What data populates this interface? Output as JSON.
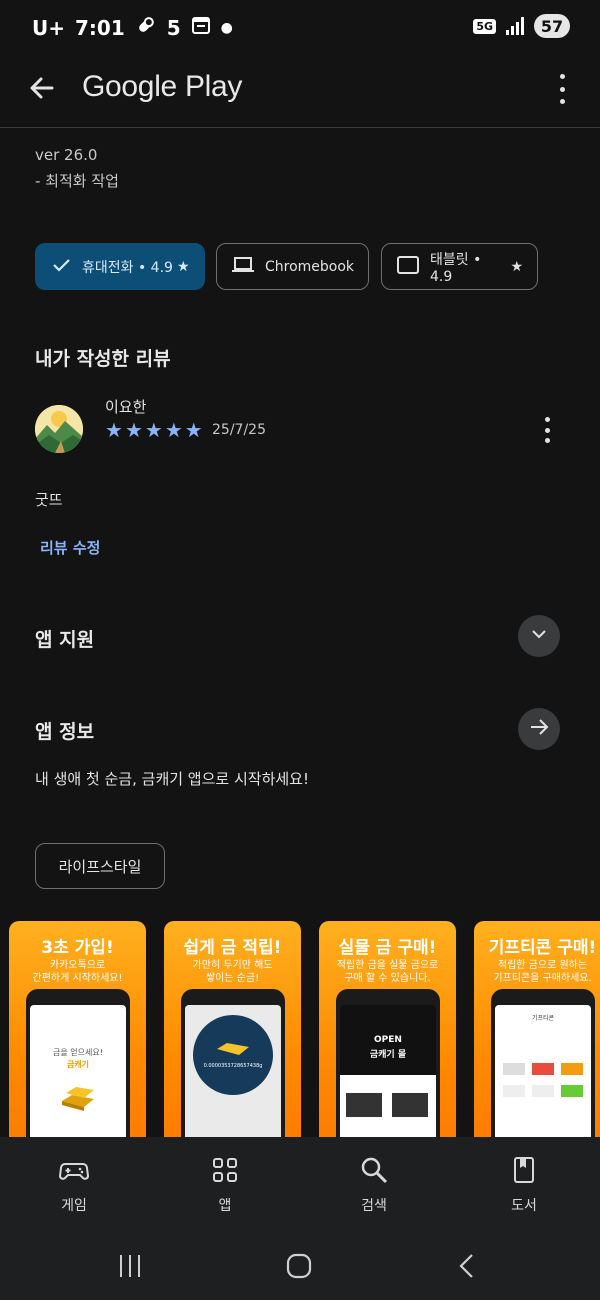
{
  "status_bar": {
    "carrier": "U+",
    "time": "7:01",
    "notification_count": "5",
    "network": "5G",
    "battery": "57"
  },
  "app_bar": {
    "title": "Google Play"
  },
  "whats_new": {
    "version": "ver 26.0",
    "note": "- 최적화 작업"
  },
  "device_chips": [
    {
      "label": "휴대전화 • 4.9",
      "icon": "check-icon",
      "star": true,
      "selected": true
    },
    {
      "label": "Chromebook",
      "icon": "laptop-icon",
      "star": false,
      "selected": false
    },
    {
      "label": "태블릿 • 4.9",
      "icon": "tablet-icon",
      "star": true,
      "selected": false
    }
  ],
  "my_review": {
    "heading": "내가 작성한 리뷰",
    "author": "이요한",
    "rating": 5,
    "date": "25/7/25",
    "text": "굿뜨",
    "edit_label": "리뷰 수정"
  },
  "app_support": {
    "heading": "앱 지원"
  },
  "app_info": {
    "heading": "앱 정보",
    "description": "내 생애 첫 순금, 금캐기 앱으로 시작하세요!",
    "category_tag": "라이프스타일"
  },
  "screenshots": [
    {
      "title": "3초 가입!",
      "subtitle": "카카오톡으로\n간편하게 시작하세요!",
      "screen_text": "금을 얻으세요!",
      "screen_accent": "금캐기"
    },
    {
      "title": "쉽게 금 적립!",
      "subtitle": "가만히 두기만 해도\n쌓이는 순금!",
      "screen_text": "0.0000353728657438g"
    },
    {
      "title": "실물 금 구매!",
      "subtitle": "적립한 금을 실물 금으로\n구매 할 수 있습니다.",
      "screen_text": "OPEN",
      "screen_accent": "금캐기 몰"
    },
    {
      "title": "기프티콘 구매!",
      "subtitle": "적립한 금으로 원하는\n기프티콘을 구매하세요.",
      "screen_text": "기프티콘"
    }
  ],
  "bottom_nav": [
    {
      "label": "게임",
      "icon": "gamepad-icon"
    },
    {
      "label": "앱",
      "icon": "apps-grid-icon"
    },
    {
      "label": "검색",
      "icon": "search-icon"
    },
    {
      "label": "도서",
      "icon": "book-icon"
    }
  ],
  "colors": {
    "background": "#131314",
    "selected_chip": "#0d4e77",
    "link": "#8ab4f8",
    "banner_orange": "#ff8a00"
  }
}
